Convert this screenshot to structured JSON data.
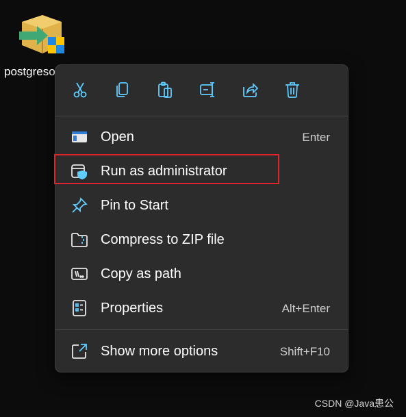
{
  "desktop": {
    "icon_name": "installer-icon",
    "label": "postgreso"
  },
  "context_menu": {
    "toolbar": [
      {
        "name": "cut-icon"
      },
      {
        "name": "copy-icon"
      },
      {
        "name": "paste-icon"
      },
      {
        "name": "rename-icon"
      },
      {
        "name": "share-icon"
      },
      {
        "name": "delete-icon"
      }
    ],
    "items": [
      {
        "label": "Open",
        "shortcut": "Enter",
        "icon": "open-icon"
      },
      {
        "label": "Run as administrator",
        "shortcut": "",
        "icon": "shield-icon"
      },
      {
        "label": "Pin to Start",
        "shortcut": "",
        "icon": "pin-icon"
      },
      {
        "label": "Compress to ZIP file",
        "shortcut": "",
        "icon": "zip-icon"
      },
      {
        "label": "Copy as path",
        "shortcut": "",
        "icon": "path-icon"
      },
      {
        "label": "Properties",
        "shortcut": "Alt+Enter",
        "icon": "properties-icon"
      }
    ],
    "more_options": {
      "label": "Show more options",
      "shortcut": "Shift+F10",
      "icon": "more-options-icon"
    }
  },
  "colors": {
    "accent": "#60cdff",
    "menu_bg": "#2c2c2c",
    "highlight": "#e0242c"
  },
  "watermark": "CSDN @Java患公"
}
